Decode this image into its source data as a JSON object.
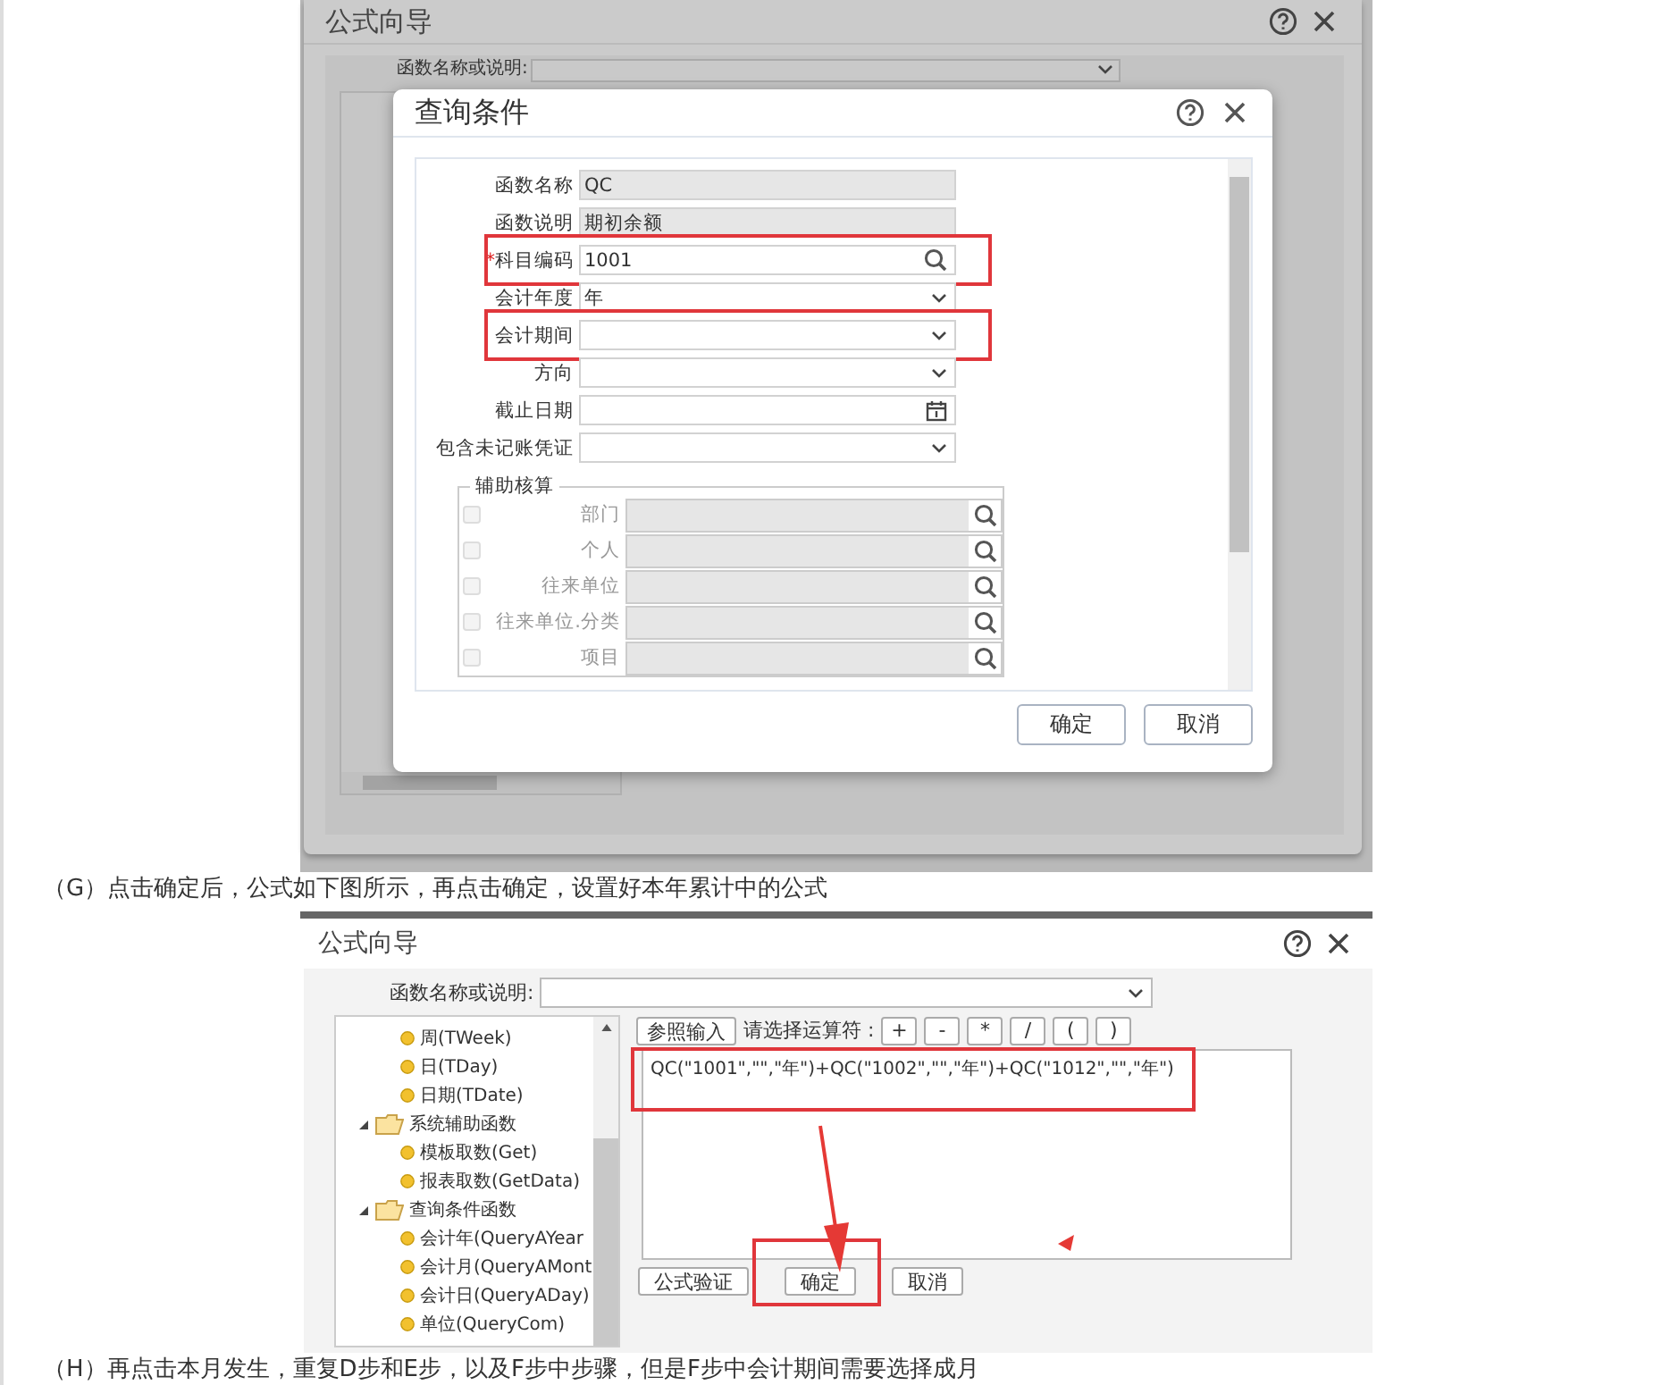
{
  "screenshot_1": {
    "outer_dialog": {
      "title": "公式向导",
      "search_label": "函数名称或说明:"
    },
    "query_dialog": {
      "title": "查询条件",
      "fields": [
        {
          "kind": "readonly",
          "label": "函数名称",
          "value": "QC",
          "highlighted": false
        },
        {
          "kind": "readonly",
          "label": "函数说明",
          "value": "期初余额",
          "highlighted": false
        },
        {
          "kind": "lookup",
          "marker": "*",
          "label": "科目编码",
          "value": "1001",
          "highlighted": true
        },
        {
          "kind": "select",
          "label": "会计年度",
          "value": "年",
          "highlighted": false
        },
        {
          "kind": "select",
          "label": "会计期间",
          "highlighted": true
        },
        {
          "kind": "select",
          "label": "方向",
          "highlighted": false
        },
        {
          "kind": "date",
          "label": "截止日期",
          "highlighted": false
        },
        {
          "kind": "select",
          "label": "包含未记账凭证",
          "highlighted": false
        }
      ],
      "aux_group": {
        "title": "辅助核算",
        "rows": [
          {
            "label": "部门",
            "checked": false
          },
          {
            "label": "个人",
            "checked": false
          },
          {
            "label": "往来单位",
            "checked": false
          },
          {
            "label": "往来单位.分类",
            "checked": false
          },
          {
            "label": "项目",
            "checked": false
          }
        ]
      },
      "buttons": [
        "确定",
        "取消"
      ]
    }
  },
  "caption_1": "（G）点击确定后，公式如下图所示，再点击确定，设置好本年累计中的公式",
  "screenshot_2": {
    "title": "公式向导",
    "search_label": "函数名称或说明:",
    "tree": [
      {
        "kind": "function",
        "label": "周(TWeek)"
      },
      {
        "kind": "function",
        "label": "日(TDay)"
      },
      {
        "kind": "function",
        "label": "日期(TDate)"
      },
      {
        "kind": "folder",
        "label": "系统辅助函数",
        "expanded": true,
        "children": [
          {
            "kind": "function",
            "label": "模板取数(Get)"
          },
          {
            "kind": "function",
            "label": "报表取数(GetData)"
          }
        ]
      },
      {
        "kind": "folder",
        "label": "查询条件函数",
        "expanded": true,
        "children": [
          {
            "kind": "function",
            "label": "会计年(QueryAYear"
          },
          {
            "kind": "function",
            "label": "会计月(QueryAMont"
          },
          {
            "kind": "function",
            "label": "会计日(QueryADay)"
          },
          {
            "kind": "function",
            "label": "单位(QueryCom)"
          }
        ]
      }
    ],
    "reference_button": "参照输入",
    "operator_label": "请选择运算符 :",
    "operators": [
      "+",
      "-",
      "*",
      "/",
      "(",
      ")"
    ],
    "formula": "QC(\"1001\",\"\",\"年\")+QC(\"1002\",\"\",\"年\")+QC(\"1012\",\"\",\"年\")",
    "formula_highlighted": true,
    "buttons": [
      {
        "label": "公式验证",
        "highlighted": false
      },
      {
        "label": "确定",
        "highlighted": true
      },
      {
        "label": "取消",
        "highlighted": false
      }
    ]
  },
  "caption_2": "（H）再点击本月发生，重复D步和E步，以及F步中步骤，但是F步中会计期间需要选择成月"
}
